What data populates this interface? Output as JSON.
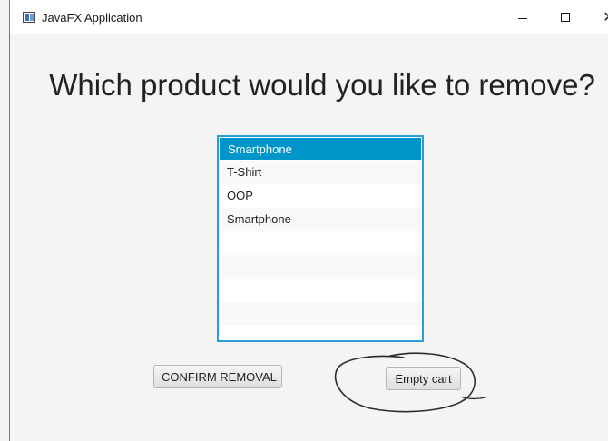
{
  "window": {
    "title": "JavaFX Application",
    "controls": {
      "minimize": "minimize-icon",
      "maximize": "maximize-icon",
      "close": "close-icon",
      "close_glyph": "✕"
    }
  },
  "main": {
    "heading": "Which product would you like to remove?",
    "products": [
      "Smartphone",
      "T-Shirt",
      "OOP",
      "Smartphone"
    ],
    "selected_index": 0,
    "confirm_label": "CONFIRM REMOVAL",
    "empty_cart_label": "Empty cart"
  },
  "colors": {
    "selection": "#0096c9",
    "list_border": "#2a9fd6",
    "background": "#f4f4f4"
  }
}
